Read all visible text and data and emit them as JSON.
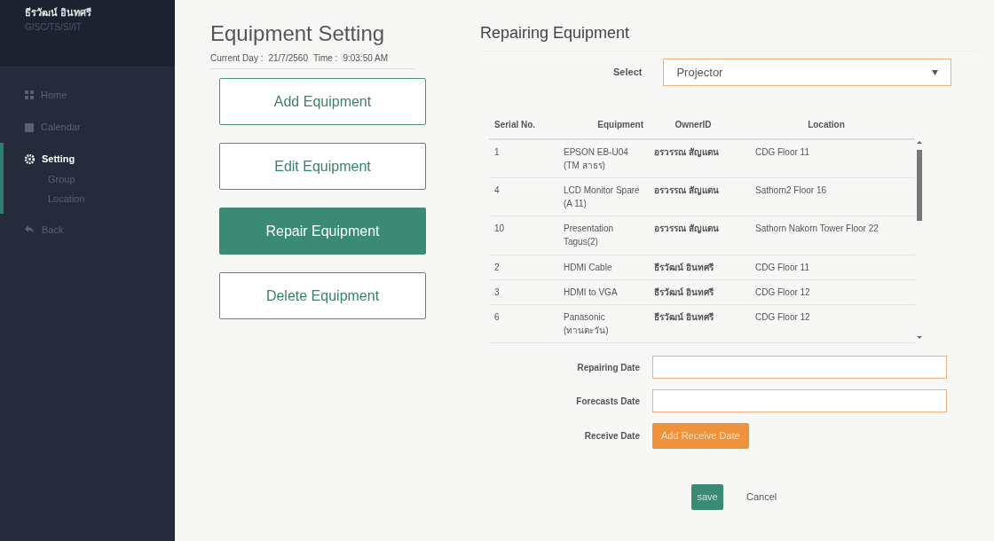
{
  "user": {
    "name": "ธีรวัฒน์ อินทศรี",
    "department": "GISC/TS/SI/IT"
  },
  "sidebar": {
    "items": [
      {
        "label": "Home",
        "kind": "home",
        "selected": false
      },
      {
        "label": "Calendar",
        "kind": "calendar",
        "selected": false
      },
      {
        "label": "Setting",
        "kind": "setting",
        "selected": true,
        "children": [
          {
            "label": "Group"
          },
          {
            "label": "Location"
          }
        ]
      },
      {
        "label": "Back",
        "kind": "back",
        "selected": false
      }
    ]
  },
  "settings": {
    "title": "Equipment Setting",
    "current_day_label": "Current  Day :",
    "current_day": "21/7/2560",
    "time_label": "Time :",
    "time": "9:03:50 AM",
    "actions": [
      {
        "label": "Add Equipment",
        "selected": false
      },
      {
        "label": "Edit Equipment",
        "selected": false
      },
      {
        "label": "Repair Equipment",
        "selected": true
      },
      {
        "label": "Delete Equipment",
        "selected": false
      }
    ]
  },
  "repair": {
    "title": "Repairing Equipment",
    "select_label": "Select",
    "select_value": "Projector",
    "table": {
      "columns": [
        "Serial No.",
        "Equipment",
        "OwnerID",
        "Location"
      ],
      "rows": [
        [
          "1",
          "EPSON EB-U04 (TM สาธร)",
          "อรวรรณ สัญแดน",
          "CDG Floor 11"
        ],
        [
          "4",
          "LCD Monitor Spare (A 11)",
          "อรวรรณ สัญแดน",
          "Sathorn2 Floor 16"
        ],
        [
          "10",
          "Presentation Tagus(2)",
          "อรวรรณ สัญแดน",
          "Sathorn Nakorn Tower Floor 22"
        ],
        [
          "2",
          "HDMI Cable",
          "ธีรวัฒน์ อินทศรี",
          "CDG Floor 11"
        ],
        [
          "3",
          "HDMI to VGA",
          "ธีรวัฒน์ อินทศรี",
          "CDG Floor 12"
        ],
        [
          "6",
          "Panasonic (ทานตะวัน)",
          "ธีรวัฒน์ อินทศรี",
          "CDG Floor 12"
        ]
      ]
    },
    "fields": [
      {
        "label": "Repairing Date",
        "kind": "input"
      },
      {
        "label": "Forecasts Date",
        "kind": "input"
      },
      {
        "label": "Receive Date",
        "kind": "button",
        "button": "Add Receive Date"
      }
    ],
    "save": "save",
    "cancel": "Cancel"
  }
}
